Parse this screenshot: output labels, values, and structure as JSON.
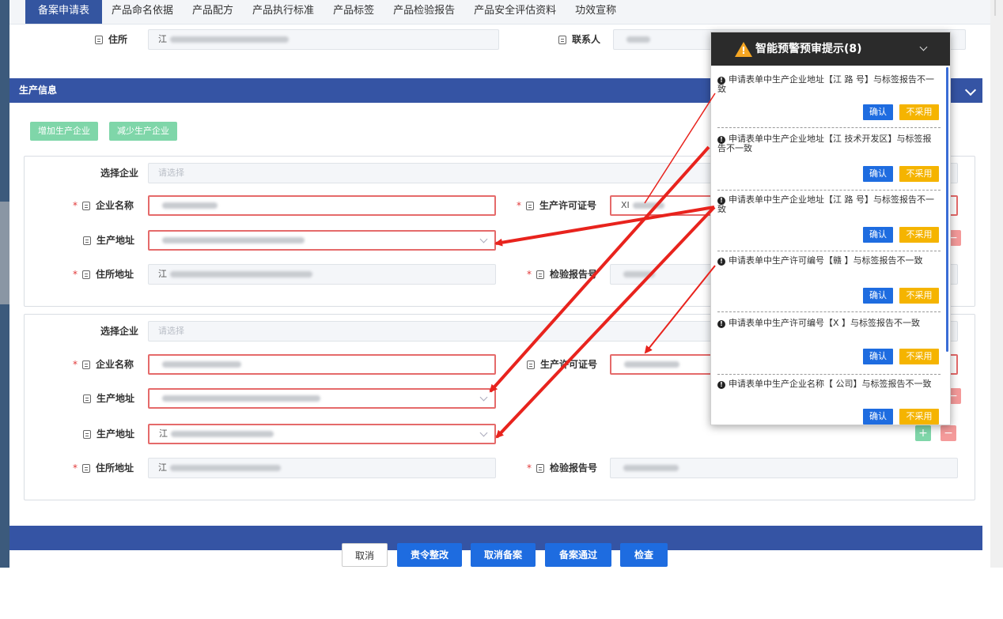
{
  "tabs": [
    "备案申请表",
    "产品命名依据",
    "产品配方",
    "产品执行标准",
    "产品标签",
    "产品检验报告",
    "产品安全评估资料",
    "功效宣称"
  ],
  "top_row": {
    "address_label": "住所",
    "address_value": "江",
    "contact_label": "联系人",
    "contact_value": ""
  },
  "production_section": {
    "title": "生产信息",
    "add_button": "增加生产企业",
    "remove_button": "减少生产企业"
  },
  "enterprise_1": {
    "select_label": "选择企业",
    "select_placeholder": "请选择",
    "name_label": "企业名称",
    "name_value": "",
    "license_label": "生产许可证号",
    "license_value": "XI",
    "prod_addr_label": "生产地址",
    "prod_addr_value": "",
    "residence_label": "住所地址",
    "residence_value": "江",
    "report_label": "检验报告号",
    "report_value": ""
  },
  "enterprise_2": {
    "select_label": "选择企业",
    "select_placeholder": "请选择",
    "name_label": "企业名称",
    "name_value": "",
    "license_label": "生产许可证号",
    "license_value": "",
    "prod_addr_label": "生产地址",
    "prod_addr_value": "",
    "prod_addr2_label": "生产地址",
    "prod_addr2_value": "江",
    "residence_label": "住所地址",
    "residence_value": "江",
    "report_label": "检验报告号",
    "report_value": ""
  },
  "next_section": {
    "title": ""
  },
  "footer": {
    "cancel": "取消",
    "rectify": "责令整改",
    "cancel_filing": "取消备案",
    "approve": "备案通过",
    "check": "检查"
  },
  "warning_panel": {
    "title": "智能预警预审提示(8)",
    "confirm_label": "确认",
    "reject_label": "不采用",
    "items": [
      "申请表单中生产企业地址【江 路 号】与标签报告不一致",
      "申请表单中生产企业地址【江 技术开发区】与标签报告不一致",
      "申请表单中生产企业地址【江 路 号】与标签报告不一致",
      "申请表单中生产许可编号【赣 】与标签报告不一致",
      "申请表单中生产许可编号【X 】与标签报告不一致",
      "申请表单中生产企业名称【 公司】与标签报告不一致"
    ]
  },
  "colors": {
    "tab_active": "#3455a0",
    "section_bar": "#3554a4",
    "primary_button": "#1e6ce0",
    "warn_orange": "#f5a623",
    "reject_yellow": "#f5b400",
    "highlight_red": "#e56a6a",
    "arrow_red": "#e8231d"
  },
  "icons": [
    "document-icon",
    "chevron-down-icon",
    "warning-triangle-icon",
    "info-circle-icon",
    "plus-icon",
    "minus-icon"
  ]
}
